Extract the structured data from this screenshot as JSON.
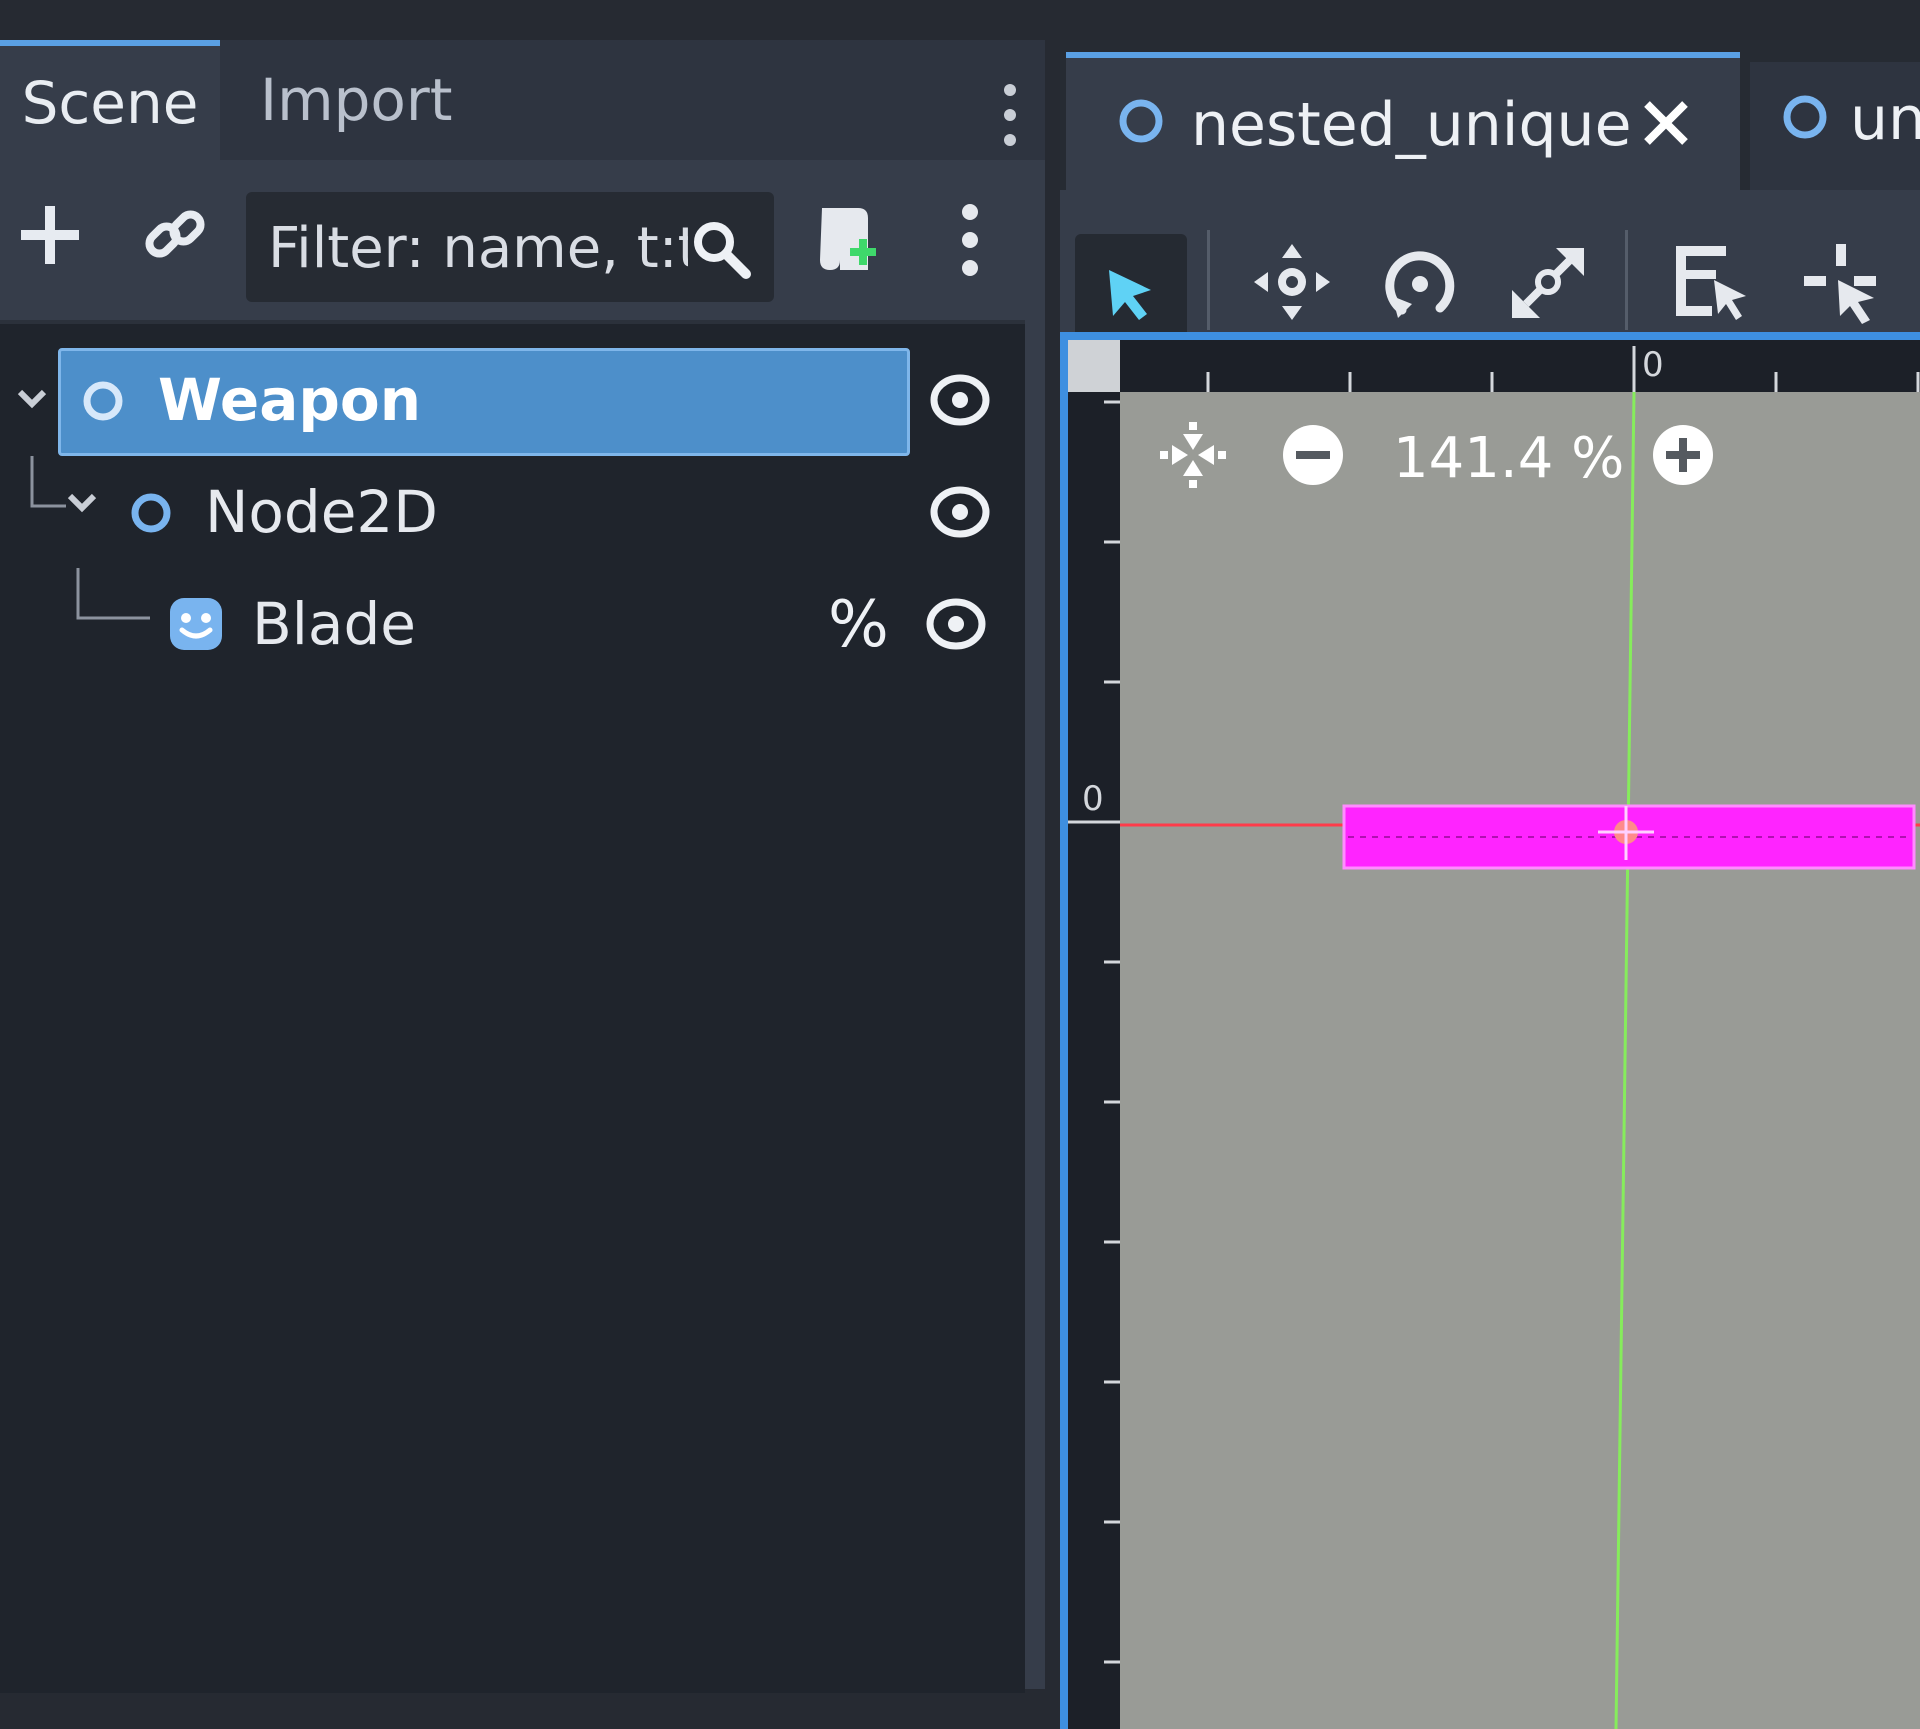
{
  "scene_dock": {
    "tabs": [
      {
        "label": "Scene",
        "active": true
      },
      {
        "label": "Import",
        "active": false
      }
    ],
    "filter": {
      "placeholder": "Filter: name, t:t"
    },
    "tree": [
      {
        "label": "Weapon",
        "type": "Node",
        "selected": true,
        "depth": 0
      },
      {
        "label": "Node2D",
        "type": "Node2D",
        "selected": false,
        "depth": 1
      },
      {
        "label": "Blade",
        "type": "Sprite2D",
        "selected": false,
        "depth": 2,
        "unique_marker": "%"
      }
    ]
  },
  "editor": {
    "scene_tabs": [
      {
        "label": "nested_unique",
        "active": true,
        "closable": true
      },
      {
        "label": "un",
        "active": false
      }
    ],
    "toolbar_tools": [
      "select-tool",
      "move-tool",
      "rotate-tool",
      "scale-tool",
      "list-select-tool",
      "pivot-tool"
    ],
    "zoom": {
      "value": "141.4 %"
    },
    "rulers": {
      "top_origin": "0",
      "left_origin": "0"
    }
  },
  "colors": {
    "accent": "#5aa0e4",
    "selection": "#4d8fca",
    "node_icon": "#79b4ef",
    "sprite": "#ff24ff",
    "x_axis": "#ff3b4a",
    "y_axis": "#86ec5c"
  }
}
